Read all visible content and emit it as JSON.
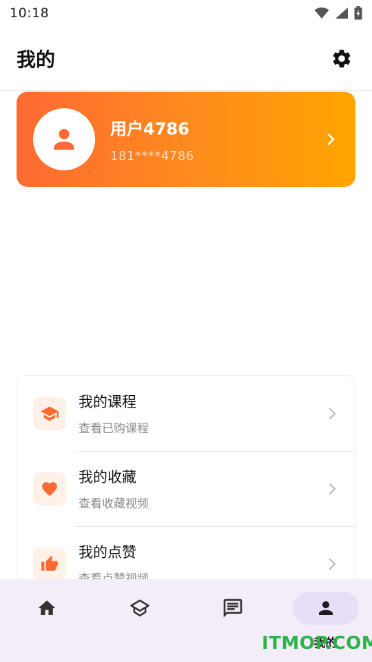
{
  "status_bar": {
    "time": "10:18"
  },
  "header": {
    "title": "我的"
  },
  "profile": {
    "name": "用户4786",
    "phone": "181****4786"
  },
  "menu": {
    "items": [
      {
        "title": "我的课程",
        "subtitle": "查看已购课程",
        "icon": "graduation-cap-icon"
      },
      {
        "title": "我的收藏",
        "subtitle": "查看收藏视频",
        "icon": "heart-icon"
      },
      {
        "title": "我的点赞",
        "subtitle": "查看点赞视频",
        "icon": "thumbs-up-icon"
      }
    ]
  },
  "bottom_nav": {
    "items": [
      {
        "icon": "home-icon",
        "label": ""
      },
      {
        "icon": "course-icon",
        "label": ""
      },
      {
        "icon": "message-icon",
        "label": ""
      },
      {
        "icon": "person-icon",
        "label": "我的"
      }
    ],
    "active_index": 3
  },
  "watermark": "ITMOP.COM",
  "colors": {
    "accent": "#ff6a33",
    "accent_end": "#ffa500",
    "nav_bg": "#f3edf7",
    "nav_active": "#e8def8",
    "watermark": "#2bb34a"
  }
}
